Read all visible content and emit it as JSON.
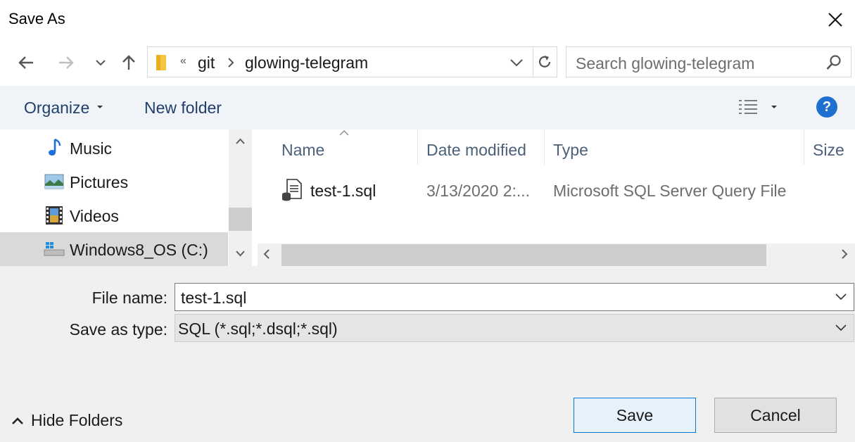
{
  "window": {
    "title": "Save As"
  },
  "address": {
    "overflow": "«",
    "crumbs": [
      "git",
      "glowing-telegram"
    ]
  },
  "search": {
    "placeholder": "Search glowing-telegram"
  },
  "toolbar": {
    "organize": "Organize",
    "new_folder": "New folder",
    "help": "?"
  },
  "nav_pane": {
    "items": [
      {
        "label": "Music",
        "icon": "music-icon"
      },
      {
        "label": "Pictures",
        "icon": "pictures-icon"
      },
      {
        "label": "Videos",
        "icon": "videos-icon"
      },
      {
        "label": "Windows8_OS (C:)",
        "icon": "drive-icon",
        "selected": true
      }
    ]
  },
  "file_list": {
    "columns": [
      "Name",
      "Date modified",
      "Type",
      "Size"
    ],
    "rows": [
      {
        "name": "test-1.sql",
        "date": "3/13/2020 2:...",
        "type": "Microsoft SQL Server Query File",
        "size": ""
      }
    ]
  },
  "form": {
    "file_name_label": "File name:",
    "file_name": "test-1.sql",
    "save_type_label": "Save as type:",
    "save_type": "SQL (*.sql;*.dsql;*.sql)"
  },
  "footer": {
    "hide_folders": "Hide Folders",
    "save": "Save",
    "cancel": "Cancel"
  },
  "colors": {
    "accent": "#0078d7",
    "toolbar_text": "#1f3f6b",
    "help_blue": "#1f6fd0"
  }
}
